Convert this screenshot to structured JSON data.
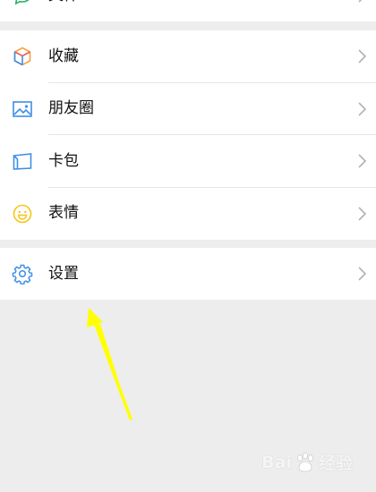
{
  "top_partial_item": {
    "label": "文件",
    "icon": "chat-file-icon"
  },
  "menu_group_1": [
    {
      "label": "收藏",
      "icon": "favorites-cube-icon"
    },
    {
      "label": "朋友圈",
      "icon": "moments-picture-icon"
    },
    {
      "label": "卡包",
      "icon": "card-wallet-icon"
    },
    {
      "label": "表情",
      "icon": "smiley-icon"
    }
  ],
  "menu_group_2": [
    {
      "label": "设置",
      "icon": "gear-icon"
    }
  ],
  "watermark": {
    "brand_left": "Bai",
    "brand_right": "经验"
  },
  "colors": {
    "background": "#ededed",
    "row_background": "#ffffff",
    "arrow": "#ffff00",
    "chevron": "#b2b2b2",
    "divider": "#e6e6e6"
  }
}
